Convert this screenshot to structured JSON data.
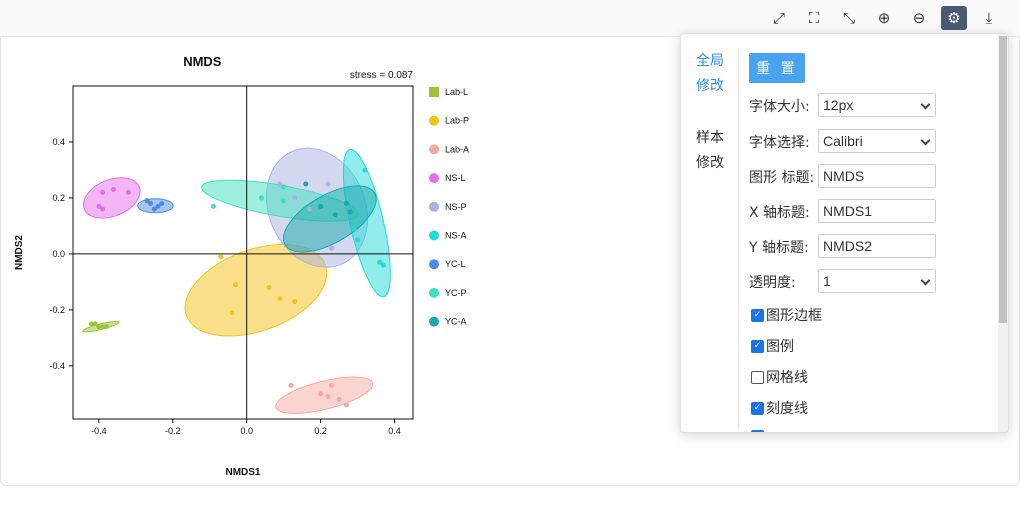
{
  "toolbar": {
    "icons": [
      "expand-diagonal-icon",
      "fullscreen-icon",
      "collapse-icon",
      "zoom-in-icon",
      "zoom-out-icon",
      "settings-icon",
      "download-icon"
    ],
    "glyphs": [
      "⤢",
      "⛶",
      "⤡",
      "⊕",
      "⊖",
      "⚙",
      "⤓"
    ],
    "active": "settings-icon"
  },
  "panel": {
    "tab_global": "全局\n修改",
    "tab_sample": "样本\n修改",
    "reset_label": "重 置",
    "font_size_label": "字体大小:",
    "font_size_value": "12px",
    "font_family_label": "字体选择:",
    "font_family_value": "Calibri",
    "title_label": "图形 标题:",
    "title_value": "NMDS",
    "xlabel_label": "X 轴标题:",
    "xlabel_value": "NMDS1",
    "ylabel_label": "Y 轴标题:",
    "ylabel_value": "NMDS2",
    "opacity_label": "透明度:",
    "opacity_value": "1",
    "checks": [
      {
        "label": "图形边框",
        "checked": true
      },
      {
        "label": "图例",
        "checked": true
      },
      {
        "label": "网格线",
        "checked": false
      },
      {
        "label": "刻度线",
        "checked": true
      }
    ]
  },
  "chart_data": {
    "type": "scatter",
    "title": "NMDS",
    "stress": "stress = 0.087",
    "xlabel": "NMDS1",
    "ylabel": "NMDS2",
    "xlim": [
      -0.47,
      0.45
    ],
    "ylim": [
      -0.59,
      0.6
    ],
    "xticks": [
      "-0.4",
      "-0.2",
      "0.0",
      "0.2",
      "0.4"
    ],
    "xtick_values": [
      -0.4,
      -0.2,
      0.0,
      0.2,
      0.4
    ],
    "yticks": [
      "-0.4",
      "-0.2",
      "0.0",
      "0.2",
      "0.4"
    ],
    "ytick_values": [
      -0.4,
      -0.2,
      0.0,
      0.2,
      0.4
    ],
    "grid": false,
    "legend_position": "right",
    "series": [
      {
        "name": "Lab-L",
        "color": "#9bc43a",
        "points": [
          [
            -0.42,
            -0.25
          ],
          [
            -0.4,
            -0.26
          ],
          [
            -0.39,
            -0.26
          ],
          [
            -0.38,
            -0.26
          ],
          [
            -0.41,
            -0.25
          ]
        ],
        "ellipse": {
          "cx": -0.395,
          "cy": -0.26,
          "rx": 0.05,
          "ry": 0.01,
          "angle": -14
        }
      },
      {
        "name": "Lab-P",
        "color": "#f5c218",
        "points": [
          [
            -0.07,
            -0.01
          ],
          [
            -0.03,
            -0.11
          ],
          [
            -0.04,
            -0.21
          ],
          [
            0.06,
            -0.12
          ],
          [
            0.09,
            -0.16
          ],
          [
            0.13,
            -0.17
          ]
        ],
        "ellipse": {
          "cx": 0.025,
          "cy": -0.13,
          "rx": 0.2,
          "ry": 0.145,
          "angle": -20
        }
      },
      {
        "name": "Lab-A",
        "color": "#f5aba0",
        "points": [
          [
            0.12,
            -0.47
          ],
          [
            0.2,
            -0.5
          ],
          [
            0.23,
            -0.47
          ],
          [
            0.22,
            -0.51
          ],
          [
            0.25,
            -0.52
          ],
          [
            0.27,
            -0.54
          ]
        ],
        "ellipse": {
          "cx": 0.21,
          "cy": -0.505,
          "rx": 0.135,
          "ry": 0.05,
          "angle": -14
        }
      },
      {
        "name": "NS-L",
        "color": "#e46ee8",
        "points": [
          [
            -0.4,
            0.17
          ],
          [
            -0.39,
            0.16
          ],
          [
            -0.39,
            0.22
          ],
          [
            -0.36,
            0.23
          ],
          [
            -0.32,
            0.22
          ]
        ],
        "ellipse": {
          "cx": -0.365,
          "cy": 0.2,
          "rx": 0.08,
          "ry": 0.065,
          "angle": -22
        }
      },
      {
        "name": "NS-P",
        "color": "#a9b3e3",
        "points": [
          [
            0.09,
            0.25
          ],
          [
            0.13,
            0.2
          ],
          [
            0.17,
            0.16
          ],
          [
            0.22,
            0.25
          ],
          [
            0.23,
            0.02
          ],
          [
            0.27,
            0.18
          ]
        ],
        "ellipse": {
          "cx": 0.19,
          "cy": 0.165,
          "rx": 0.13,
          "ry": 0.22,
          "angle": -24
        }
      },
      {
        "name": "NS-A",
        "color": "#21dbd8",
        "points": [
          [
            0.32,
            0.3
          ],
          [
            0.29,
            0.09
          ],
          [
            0.3,
            0.05
          ],
          [
            0.36,
            -0.03
          ],
          [
            0.37,
            -0.04
          ]
        ],
        "ellipse": {
          "cx": 0.325,
          "cy": 0.11,
          "rx": 0.045,
          "ry": 0.27,
          "angle": -13
        }
      },
      {
        "name": "YC-L",
        "color": "#4d8be0",
        "points": [
          [
            -0.27,
            0.19
          ],
          [
            -0.25,
            0.16
          ],
          [
            -0.24,
            0.17
          ],
          [
            -0.23,
            0.18
          ],
          [
            -0.26,
            0.18
          ]
        ],
        "ellipse": {
          "cx": -0.247,
          "cy": 0.172,
          "rx": 0.048,
          "ry": 0.025,
          "angle": 0
        }
      },
      {
        "name": "YC-P",
        "color": "#3fe0c0",
        "points": [
          [
            -0.09,
            0.17
          ],
          [
            0.04,
            0.2
          ],
          [
            0.1,
            0.24
          ],
          [
            0.1,
            0.19
          ],
          [
            0.2,
            0.17
          ],
          [
            0.24,
            0.21
          ]
        ],
        "ellipse": {
          "cx": 0.09,
          "cy": 0.19,
          "rx": 0.215,
          "ry": 0.055,
          "angle": 10
        }
      },
      {
        "name": "YC-A",
        "color": "#19a8ac",
        "points": [
          [
            0.16,
            0.25
          ],
          [
            0.2,
            0.17
          ],
          [
            0.24,
            0.14
          ],
          [
            0.27,
            0.18
          ],
          [
            0.28,
            0.15
          ]
        ],
        "ellipse": {
          "cx": 0.225,
          "cy": 0.125,
          "rx": 0.14,
          "ry": 0.085,
          "angle": -30
        }
      }
    ]
  }
}
